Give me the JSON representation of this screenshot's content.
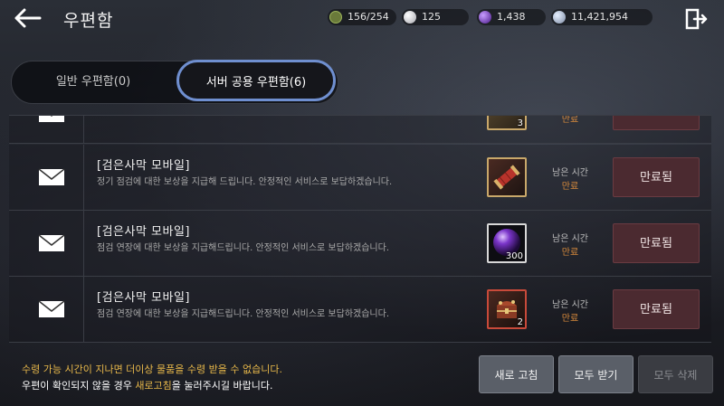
{
  "header": {
    "title": "우편함",
    "resources": [
      {
        "icon": "energy-icon",
        "value": "156/254"
      },
      {
        "icon": "pearl-icon",
        "value": "125"
      },
      {
        "icon": "purple-orb-icon",
        "value": "1,438"
      },
      {
        "icon": "silver-coin-icon",
        "value": "11,421,954"
      }
    ]
  },
  "tabs": [
    {
      "label": "일반 우편함(0)",
      "active": false
    },
    {
      "label": "서버 공용 우편함(6)",
      "active": true
    }
  ],
  "mail": {
    "partial_row": {
      "remain_value": "만료",
      "item_qty": "3"
    },
    "items": [
      {
        "sender": "[검은사막 모바일]",
        "message": "정기 점검에 대한 보상을 지급해 드립니다. 안정적인 서비스로 보답하겠습니다.",
        "item_icon": "red-scroll-icon",
        "item_qty": "",
        "remain_label": "남은 시간",
        "remain_value": "만료",
        "button": "만료됨"
      },
      {
        "sender": "[검은사막 모바일]",
        "message": "점검 연장에 대한 보상을 지급해드립니다. 안정적인 서비스로 보답하겠습니다.",
        "item_icon": "purple-orb-icon",
        "item_qty": "300",
        "remain_label": "남은 시간",
        "remain_value": "만료",
        "button": "만료됨"
      },
      {
        "sender": "[검은사막 모바일]",
        "message": "점검 연장에 대한 보상을 지급해드립니다. 안정적인 서비스로 보답하겠습니다.",
        "item_icon": "treasure-chest-icon",
        "item_qty": "2",
        "remain_label": "남은 시간",
        "remain_value": "만료",
        "button": "만료됨"
      }
    ]
  },
  "footer": {
    "notice_line1": "수령 가능 시간이 지나면 더이상 물품을 수령 받을 수 없습니다.",
    "notice_line2_pre": "우편이 확인되지 않을 경우 ",
    "notice_line2_hl": "새로고침",
    "notice_line2_post": "을 눌러주시길 바랍니다.",
    "refresh_label": "새로 고침",
    "receive_all_label": "모두 받기",
    "delete_all_label": "모두 삭제"
  },
  "colors": {
    "accent_tab_border": "#6f8fd0",
    "expired_text": "#d98b3c",
    "notice_yellow": "#e8b84a",
    "expired_button_bg": "#4b2a30"
  }
}
